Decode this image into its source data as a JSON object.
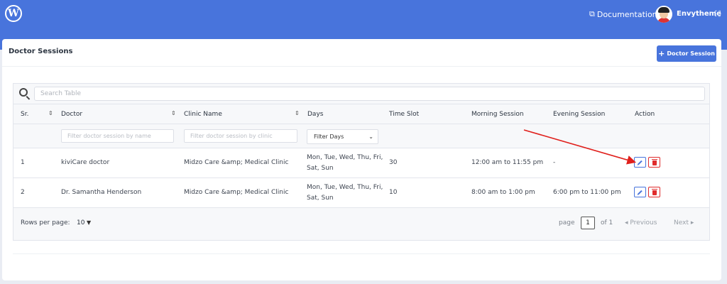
{
  "topbar": {
    "documentation_label": "Documentation",
    "username": "Envytheme"
  },
  "page": {
    "title": "Doctor Sessions",
    "add_button_label": "Doctor Session"
  },
  "search": {
    "placeholder": "Search Table"
  },
  "table": {
    "columns": [
      "Sr.",
      "Doctor",
      "Clinic Name",
      "Days",
      "Time Slot",
      "Morning Session",
      "Evening Session",
      "Action"
    ],
    "filters": {
      "doctor_placeholder": "Filter doctor session by name",
      "clinic_placeholder": "Filter doctor session by clinic",
      "days_selected": "Filter Days"
    },
    "rows": [
      {
        "sr": "1",
        "doctor": "kiviCare doctor",
        "clinic": "Midzo Care &amp; Medical Clinic",
        "days_line1": "Mon, Tue, Wed, Thu, Fri,",
        "days_line2": "Sat, Sun",
        "time_slot": "30",
        "morning": "12:00 am to 11:55 pm",
        "evening": "-"
      },
      {
        "sr": "2",
        "doctor": "Dr. Samantha Henderson",
        "clinic": "Midzo Care &amp; Medical Clinic",
        "days_line1": "Mon, Tue, Wed, Thu, Fri,",
        "days_line2": "Sat, Sun",
        "time_slot": "10",
        "morning": "8:00 am to 1:00 pm",
        "evening": "6:00 pm to 11:00 pm"
      }
    ]
  },
  "pagination": {
    "rows_per_page_label": "Rows per page:",
    "rows_per_page_value": "10",
    "page_label": "page",
    "current_page": "1",
    "of_label": "of 1",
    "previous_label": "Previous",
    "next_label": "Next"
  },
  "colors": {
    "brand": "#4874dc",
    "danger": "#e02c2c",
    "annotation": "#e0201c"
  }
}
